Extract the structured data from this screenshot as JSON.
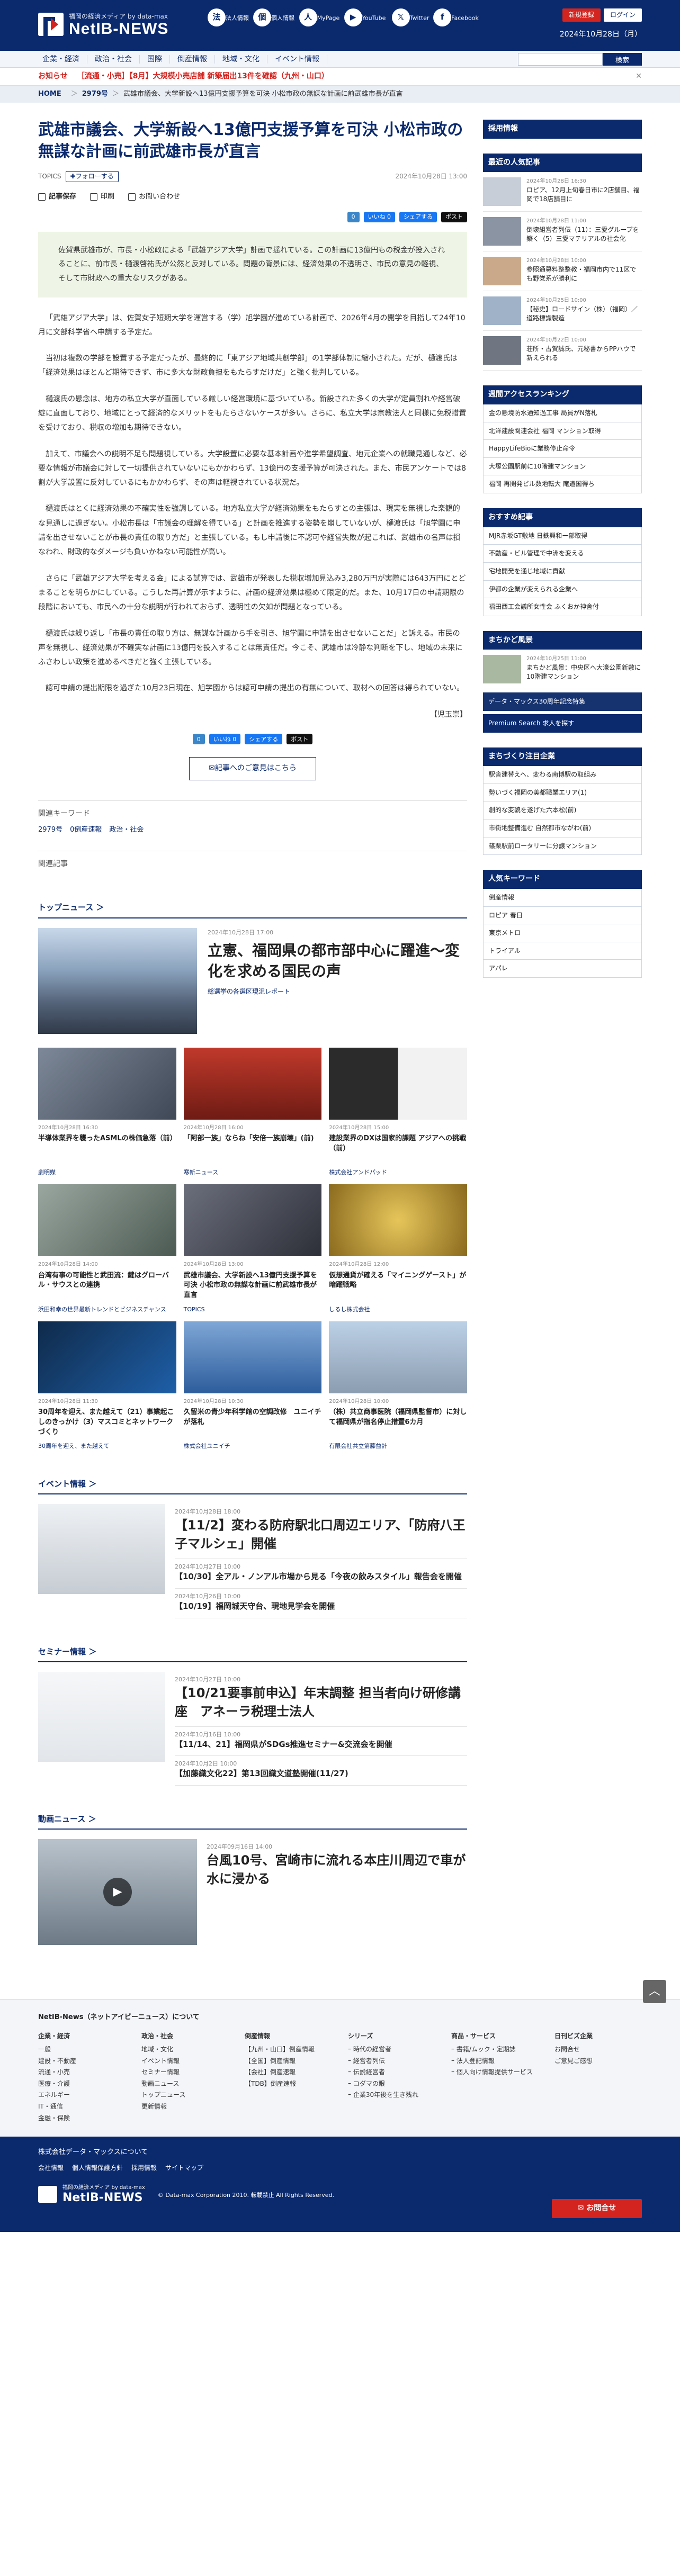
{
  "brand": {
    "tagline": "福岡の経済メディア by data-max",
    "name": "NetIB-NEWS"
  },
  "header_icons": [
    {
      "label": "法人情報",
      "glyph": "法"
    },
    {
      "label": "個人情報",
      "glyph": "個"
    },
    {
      "label": "MyPage",
      "glyph": "人"
    },
    {
      "label": "YouTube",
      "glyph": "▶"
    },
    {
      "label": "Twitter",
      "glyph": "𝕏"
    },
    {
      "label": "Facebook",
      "glyph": "f"
    }
  ],
  "header_right": {
    "register": "新規登録",
    "login": "ログイン",
    "date": "2024年10月28日（月）"
  },
  "nav": [
    "企業・経済",
    "政治・社会",
    "国際",
    "倒産情報",
    "地域・文化",
    "イベント情報"
  ],
  "search": {
    "placeholder": "",
    "button": "検索"
  },
  "ticker": {
    "label": "お知らせ",
    "text": "［流通・小売］【8月】大規模小売店舗 新築届出13件を確認（九州・山口）",
    "close": "✕"
  },
  "breadcrumb": {
    "home": "HOME",
    "num": "2979号",
    "title": "武雄市議会、大学新設へ13億円支援予算を可決 小松市政の無謀な計画に前武雄市長が直言"
  },
  "article": {
    "title": "武雄市議会、大学新設へ13億円支援予算を可決 小松市政の無謀な計画に前武雄市長が直言",
    "topics": "TOPICS",
    "follow": "✚フォローする",
    "date": "2024年10月28日 13:00",
    "tools": [
      "記事保存",
      "印刷",
      "お問い合わせ"
    ],
    "share": [
      "0",
      "いいね 0",
      "シェアする",
      "ポスト"
    ],
    "lead": "佐賀県武雄市が、市長・小松政による「武雄アジア大学」計画で揺れている。この計画に13億円もの税金が投入されることに、前市長・樋渡啓祐氏が公然と反対している。問題の背景には、経済効果の不透明さ、市民の意見の軽視、そして市財政への重大なリスクがある。",
    "body": [
      "「武雄アジア大学」は、佐賀女子短期大学を運営する（学）旭学園が進めている計画で、2026年4月の開学を目指して24年10月に文部科学省へ申請する予定だ。",
      "当初は複数の学部を設置する予定だったが、最終的に「東アジア地域共創学部」の1学部体制に縮小された。だが、樋渡氏は「経済効果はほとんど期待できず、市に多大な財政負担をもたらすだけだ」と強く批判している。",
      "樋渡氏の懸念は、地方の私立大学が直面している厳しい経営環境に基づいている。新設された多くの大学が定員割れや経営破綻に直面しており、地域にとって経済的なメリットをもたらさないケースが多い。さらに、私立大学は宗教法人と同様に免税措置を受けており、税収の増加も期待できない。",
      "加えて、市議会への説明不足も問題視している。大学設置に必要な基本計画や進学希望調査、地元企業への就職見通しなど、必要な情報が市議会に対して一切提供されていないにもかかわらず、13億円の支援予算が可決された。また、市民アンケートでは8割が大学設置に反対しているにもかかわらず、その声は軽視されている状況だ。",
      "樋渡氏はとくに経済効果の不確実性を強調している。地方私立大学が経済効果をもたらすとの主張は、現実を無視した楽観的な見通しに過ぎない。小松市長は「市議会の理解を得ている」と計画を推進する姿勢を崩していないが、樋渡氏は「旭学園に申請を出させないことが市長の責任の取り方だ」と主張している。もし申請後に不認可や経営失敗が起これば、武雄市の名声は損なわれ、財政的なダメージも負いかねない可能性が高い。",
      "さらに「武雄アジア大学を考える会」による試算では、武雄市が発表した税収増加見込み3,280万円が実際には643万円にとどまることを明らかにしている。こうした再計算が示すように、計画の経済効果は極めて限定的だ。また、10月17日の申請期限の段階においても、市民への十分な説明が行われておらず、透明性の欠如が問題となっている。",
      "樋渡氏は繰り返し「市長の責任の取り方は、無謀な計画から手を引き、旭学園に申請を出させないことだ」と訴える。市民の声を無視し、経済効果が不確実な計画に13億円を投入することは無責任だ。今こそ、武雄市は冷静な判断を下し、地域の未来にふさわしい政策を進めるべきだと強く主張している。",
      "認可申請の提出期限を過ぎた10月23日現在、旭学園からは認可申請の提出の有無について、取材への回答は得られていない。"
    ],
    "sign": "【児玉崇】",
    "feedback": "✉記事へのご意見はこちら",
    "kw_title": "関連キーワード",
    "keywords": [
      "2979号",
      "0倒産速報",
      "政治・社会"
    ],
    "related": "関連記事"
  },
  "top_news": {
    "title": "トップニュース ＞",
    "feature": {
      "date": "2024年10月28日 17:00",
      "title": "立憲、福岡県の都市部中心に躍進〜変化を求める国民の声",
      "cat": "総選挙の各選区現況レポート"
    },
    "cards": [
      {
        "date": "2024年10月28日 16:30",
        "title": "半導体業界を襲ったASMLの株価急落（前）",
        "cat": "劇明媒"
      },
      {
        "date": "2024年10月28日 16:00",
        "title": "「阿部一族」ならね「安倍一族崩壊」(前)",
        "cat": "寒新ニュース"
      },
      {
        "date": "2024年10月28日 15:00",
        "title": "建設業界のDXは国家的課題 アジアへの挑戦（前）",
        "cat": "株式会社アンドパッド"
      },
      {
        "date": "2024年10月28日 14:00",
        "title": "台湾有事の可能性と武田流：鍵はグローバル・サウスとの連携",
        "cat": "浜田和幸の世界最新トレンドとビジネスチャンス"
      },
      {
        "date": "2024年10月28日 13:00",
        "title": "武雄市議会、大学新設へ13億円支援予算を可決 小松市政の無謀な計画に前武雄市長が直言",
        "cat": "TOPICS"
      },
      {
        "date": "2024年10月28日 12:00",
        "title": "仮想通貨が確える「マイニングゲースト」が暗躍戦略",
        "cat": "しるし株式会社"
      },
      {
        "date": "2024年10月28日 11:30",
        "title": "30周年を迎え、また越えて（21）事業起こしのきっかけ（3）マスコミとネットワークづくり",
        "cat": "30周年を迎え、また越えて"
      },
      {
        "date": "2024年10月28日 10:30",
        "title": "久留米の青少年科学館の空調改修　ユニイチが落札",
        "cat": "株式会社ユニイチ"
      },
      {
        "date": "2024年10月28日 10:00",
        "title": "（株）共立商事医院（福岡県監督市）に対して福岡県が指名停止措置6カ月",
        "cat": "有限会社共立第藤益計"
      }
    ]
  },
  "events": {
    "title": "イベント情報 ＞",
    "items": [
      {
        "date": "2024年10月28日 18:00",
        "title": "【11/2】変わる防府駅北口周辺エリア、「防府八王子マルシェ」開催"
      },
      {
        "date": "2024年10月27日 10:00",
        "title": "【10/30】全アル・ノンアル市場から見る「今夜の飲みスタイル」報告会を開催"
      },
      {
        "date": "2024年10月26日 10:00",
        "title": "【10/19】福岡城天守台、現地見学会を開催"
      }
    ]
  },
  "seminar": {
    "title": "セミナー情報 ＞",
    "items": [
      {
        "date": "2024年10月27日 10:00",
        "title": "【10/21要事前申込】年末調整 担当者向け研修講座　アネーラ税理士法人"
      },
      {
        "date": "2024年10月16日 10:00",
        "title": "【11/14、21】福岡県がSDGs推進セミナー&交流会を開催"
      },
      {
        "date": "2024年10月2日 10:00",
        "title": "【加藤織文化22】第13回織文道塾開催(11/27)"
      }
    ]
  },
  "video": {
    "title": "動画ニュース ＞",
    "item": {
      "date": "2024年09月16日 14:00",
      "title": "台風10号、宮崎市に流れる本庄川周辺で車が水に浸かる"
    }
  },
  "sidebar": {
    "ad_title": "採用情報",
    "latest_title": "最近の人気記事",
    "latest": [
      {
        "date": "2024年10月28日 16:30",
        "title": "ロピア、12月上旬春日市に2店舗目、福岡で18店舗目に"
      },
      {
        "date": "2024年10月28日 11:00",
        "title": "倒壊組営者列伝（11）：三愛グループを築く（5）三愛マテリアルの社会化"
      },
      {
        "date": "2024年10月28日 10:00",
        "title": "参照通募料整整教・福岡市内で11区でも野党系が勝利に"
      },
      {
        "date": "2024年10月25日 10:00",
        "title": "【秘史】ロードサイン（株）（福岡）／道路標識製造"
      },
      {
        "date": "2024年10月22日 10:00",
        "title": "荘所・古賀誠氏、元秘書からPPハウで新えられる"
      }
    ],
    "access_title": "週間アクセスランキング",
    "access": [
      "金の懸境防水通知過工事 局員がN落札",
      "北洋建設関連会社 福岡 マンション取得",
      "HappyLifeBioに業務停止命令",
      "大塚公園駅前に10階建マンション",
      "福岡 再開発ビル数地転大 庵道国得ち"
    ],
    "osusume_title": "おすすめ記事",
    "osusume": [
      "MJR赤坂GT敷地 日鉄興和ー部取得",
      "不動産・ビル管理で中洲を変える",
      "宅地開発を通じ地域に貢献",
      "伊都の企業が変えられる企業へ",
      "福田西工会議所女性会 ふくおか神舎付"
    ],
    "town_title": "まちかど風景",
    "town": {
      "date": "2024年10月25日 11:00",
      "title": "まちかど風景：中央区へ大濠公園新敷に10階建マンション"
    },
    "banner1": "データ・マックス30周年記念特集",
    "banner2": "Premium Search 求人を探す",
    "machi_title": "まちづくり注目企業",
    "machi": [
      "駅舎建替えへ、変わる南博駅の取組み",
      "勢いづく福岡の美都職業エリア(1)",
      "創的な変貌を遂げた六本松(前)",
      "市街地整備進む 自然都市ながわ(前)",
      "篠栗駅前ロータリーに分譲マンション"
    ],
    "kw_title": "人気キーワード",
    "kw": [
      "倒産情報",
      "ロピア 春日",
      "東京メトロ",
      "トライアル",
      "アパレ"
    ]
  },
  "footer": {
    "title": "NetIB-News（ネットアイビーニュース）について",
    "cols": [
      {
        "head": "企業・経済",
        "items": [
          "一般",
          "建設・不動産",
          "流通・小売",
          "医療・介護",
          "エネルギー",
          "IT・通信",
          "金融・保険"
        ]
      },
      {
        "head": "政治・社会",
        "items": [
          "地域・文化",
          "イベント情報",
          "セミナー情報",
          "動画ニュース",
          "トップニュース",
          "更新情報"
        ]
      },
      {
        "head": "倒産情報",
        "items": [
          "【九州・山口】倒産情報",
          "【全国】倒産情報",
          "【会社】倒産速報",
          "【TDB】倒産速報"
        ]
      },
      {
        "head": "シリーズ",
        "items": [
          "ｰ 時代の経営者",
          "ｰ 経営者列伝",
          "ｰ 伝説経営者",
          "ｰ コダマの眼",
          "ｰ 企業30年後を生き残れ"
        ]
      },
      {
        "head": "商品・サービス",
        "items": [
          "ｰ 書籍/ムック・定期誌",
          "ｰ 法人登記情報",
          "ｰ 個人向け情報提供サービス"
        ]
      },
      {
        "head": "日刊ビズ企業",
        "items": [
          "お問合せ",
          "ご意見ご感想"
        ]
      }
    ],
    "company": "株式会社データ・マックスについて",
    "links": [
      "会社情報",
      "個人情報保護方針",
      "採用情報",
      "サイトマップ"
    ],
    "copy": "© Data-max Corporation 2010. 転載禁止 All Rights Reserved.",
    "contact": "✉ お問合せ"
  }
}
